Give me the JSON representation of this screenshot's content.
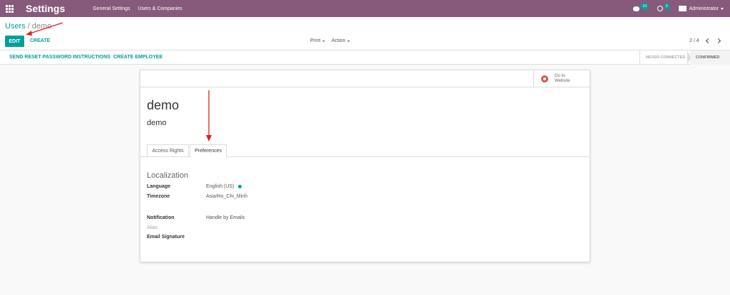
{
  "navbar": {
    "app_title": "Settings",
    "menu": [
      "General Settings",
      "Users & Companies"
    ],
    "messages_count": "10",
    "activities_count": "5",
    "user": "Administrator"
  },
  "breadcrumb": {
    "parent": "Users",
    "separator": "/",
    "current": "demo"
  },
  "toolbar": {
    "edit_label": "EDIT",
    "create_label": "CREATE",
    "print_label": "Print",
    "action_label": "Action",
    "pager": "2 / 4"
  },
  "statusbar": {
    "send_reset_label": "SEND RESET PASSWORD INSTRUCTIONS",
    "create_employee_label": "CREATE EMPLOYEE",
    "states": [
      "NEVER CONNECTED",
      "CONFIRMED"
    ]
  },
  "form": {
    "website_button": [
      "Go to",
      "Website"
    ],
    "name": "demo",
    "login": "demo",
    "tabs": [
      "Access Rights",
      "Preferences"
    ],
    "section_title": "Localization",
    "fields": {
      "language_label": "Language",
      "language_value": "English (US)",
      "timezone_label": "Timezone",
      "timezone_value": "Asia/Ho_Chi_Minh",
      "notification_label": "Notification",
      "notification_value": "Handle by Emails",
      "alias_label": "Alias",
      "signature_label": "Email Signature"
    }
  },
  "colors": {
    "brand": "#875a7b",
    "accent": "#00a09d",
    "annotation": "#e02020"
  }
}
